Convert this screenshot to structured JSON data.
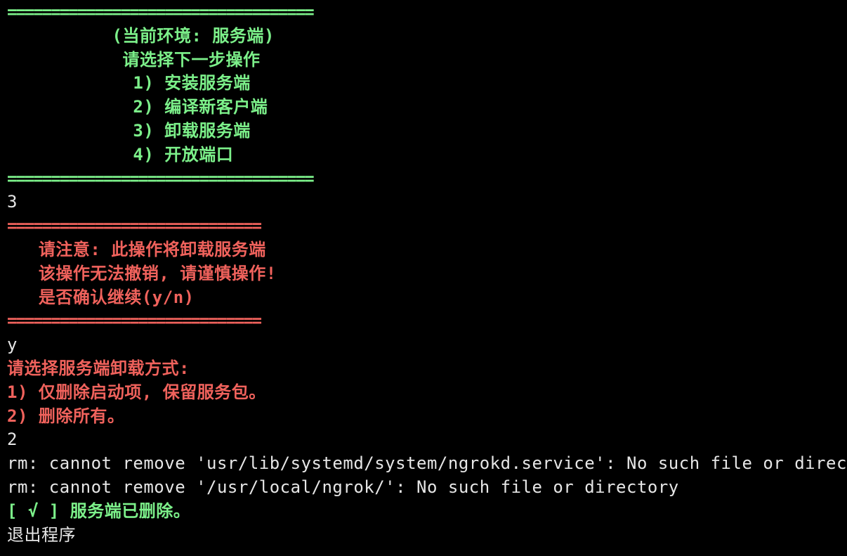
{
  "terminal": {
    "lines": [
      {
        "text": "===================================",
        "color": "#7cf08a",
        "kind": "separator"
      },
      {
        "text": "          (当前环境: 服务端)",
        "color": "#7cf08a",
        "kind": "menu-header"
      },
      {
        "text": "           请选择下一步操作",
        "color": "#7cf08a",
        "kind": "menu-prompt"
      },
      {
        "text": "            1) 安装服务端",
        "color": "#7cf08a",
        "kind": "menu-option"
      },
      {
        "text": "            2) 编译新客户端",
        "color": "#7cf08a",
        "kind": "menu-option"
      },
      {
        "text": "            3) 卸载服务端",
        "color": "#7cf08a",
        "kind": "menu-option"
      },
      {
        "text": "            4) 开放端口",
        "color": "#7cf08a",
        "kind": "menu-option"
      },
      {
        "text": "===================================",
        "color": "#7cf08a",
        "kind": "separator"
      },
      {
        "text": "3",
        "color": "#e6e6e6",
        "kind": "user-input"
      },
      {
        "text": "=============================",
        "color": "#f0625c",
        "kind": "separator"
      },
      {
        "text": "   请注意: 此操作将卸载服务端",
        "color": "#f0625c",
        "kind": "warning"
      },
      {
        "text": "   该操作无法撤销, 请谨慎操作!",
        "color": "#f0625c",
        "kind": "warning"
      },
      {
        "text": "   是否确认继续(y/n)",
        "color": "#f0625c",
        "kind": "warning"
      },
      {
        "text": "=============================",
        "color": "#f0625c",
        "kind": "separator"
      },
      {
        "text": "y",
        "color": "#e6e6e6",
        "kind": "user-input"
      },
      {
        "text": "请选择服务端卸载方式:",
        "color": "#f0625c",
        "kind": "prompt"
      },
      {
        "text": "1) 仅删除启动项, 保留服务包。",
        "color": "#f0625c",
        "kind": "option"
      },
      {
        "text": "2) 删除所有。",
        "color": "#f0625c",
        "kind": "option"
      },
      {
        "text": "2",
        "color": "#e6e6e6",
        "kind": "user-input"
      },
      {
        "text": "rm: cannot remove 'usr/lib/systemd/system/ngrokd.service': No such file or directory",
        "color": "#e6e6e6",
        "kind": "error-output"
      },
      {
        "text": "rm: cannot remove '/usr/local/ngrok/': No such file or directory",
        "color": "#e6e6e6",
        "kind": "error-output"
      },
      {
        "text": "[ √ ] 服务端已删除。",
        "color": "#7cf08a",
        "kind": "success"
      },
      {
        "text": "退出程序",
        "color": "#e6e6e6",
        "kind": "output"
      }
    ]
  }
}
